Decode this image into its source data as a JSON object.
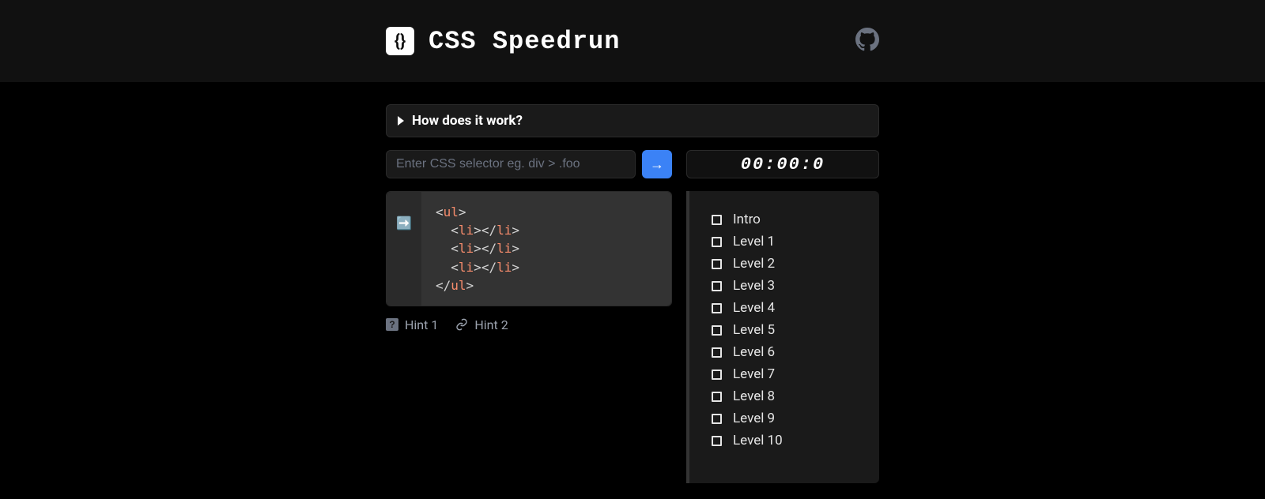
{
  "header": {
    "title": "CSS Speedrun"
  },
  "details": {
    "title": "How does it work?"
  },
  "input": {
    "placeholder": "Enter CSS selector eg. div > .foo",
    "value": ""
  },
  "timer": "00:00:0",
  "code": {
    "pointer_emoji": "➡️",
    "lines": [
      {
        "indent": 0,
        "open": "ul",
        "close": ""
      },
      {
        "indent": 1,
        "open": "li",
        "close": "li"
      },
      {
        "indent": 1,
        "open": "li",
        "close": "li"
      },
      {
        "indent": 1,
        "open": "li",
        "close": "li"
      },
      {
        "indent": 0,
        "open": "",
        "close": "ul"
      }
    ]
  },
  "hints": [
    {
      "label": "Hint 1",
      "icon": "question"
    },
    {
      "label": "Hint 2",
      "icon": "link"
    }
  ],
  "levels": [
    {
      "label": "Intro",
      "done": false
    },
    {
      "label": "Level 1",
      "done": false
    },
    {
      "label": "Level 2",
      "done": false
    },
    {
      "label": "Level 3",
      "done": false
    },
    {
      "label": "Level 4",
      "done": false
    },
    {
      "label": "Level 5",
      "done": false
    },
    {
      "label": "Level 6",
      "done": false
    },
    {
      "label": "Level 7",
      "done": false
    },
    {
      "label": "Level 8",
      "done": false
    },
    {
      "label": "Level 9",
      "done": false
    },
    {
      "label": "Level 10",
      "done": false
    }
  ]
}
